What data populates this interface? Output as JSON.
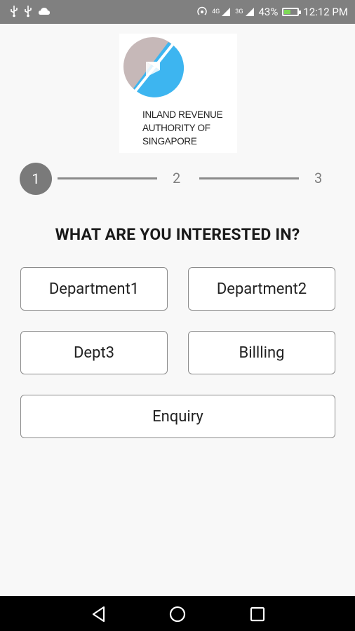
{
  "status_bar": {
    "signal_labels": [
      "4G",
      "3G"
    ],
    "battery_percent": "43%",
    "battery_level": 0.43,
    "time": "12:12 PM"
  },
  "logo": {
    "lines": [
      "INLAND REVENUE",
      "AUTHORITY OF",
      "SINGAPORE"
    ]
  },
  "stepper": {
    "steps": [
      "1",
      "2",
      "3"
    ],
    "active_step": 1
  },
  "heading": "WHAT ARE YOU INTERESTED IN?",
  "options": [
    {
      "label": "Department1"
    },
    {
      "label": "Department2"
    },
    {
      "label": "Dept3"
    },
    {
      "label": "Billling"
    },
    {
      "label": "Enquiry"
    }
  ],
  "colors": {
    "status_bar": "#808080",
    "active_step": "#7a7a7a",
    "logo_blue": "#3db5f0",
    "logo_grey": "#c6b8b8"
  },
  "nav": {
    "icons": [
      "back-icon",
      "home-icon",
      "recents-icon"
    ]
  }
}
